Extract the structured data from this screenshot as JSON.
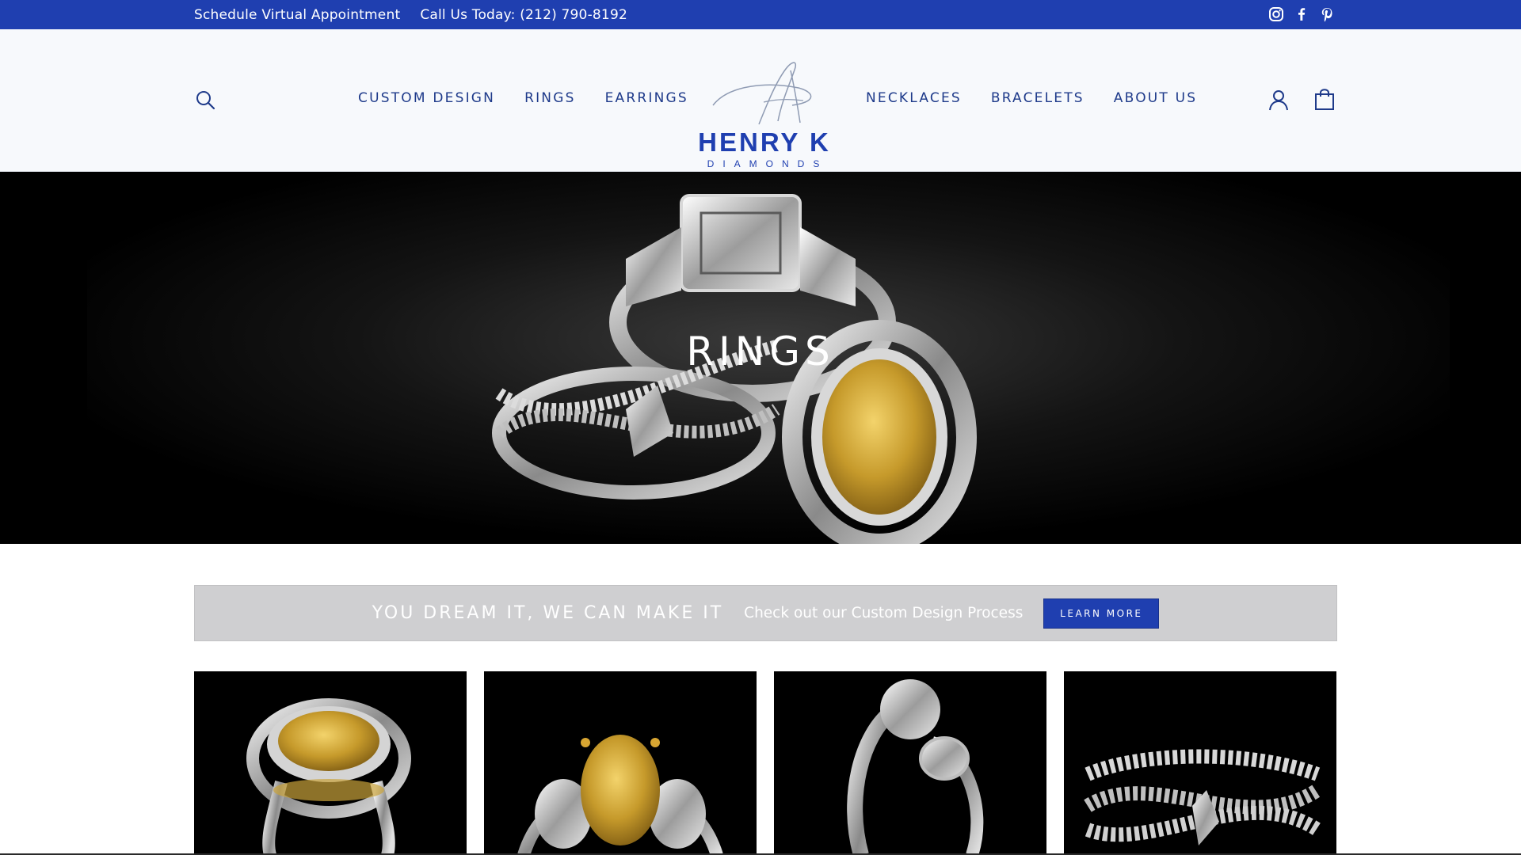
{
  "topbar": {
    "schedule_link": "Schedule Virtual Appointment",
    "phone_link": "Call Us Today: (212) 790-8192",
    "social": [
      "instagram-icon",
      "facebook-icon",
      "pinterest-icon"
    ]
  },
  "header": {
    "nav_left": [
      "CUSTOM DESIGN",
      "RINGS",
      "EARRINGS"
    ],
    "nav_right": [
      "NECKLACES",
      "BRACELETS",
      "ABOUT US"
    ],
    "logo_line1": "HENRY K",
    "logo_line2": "DIAMONDS",
    "icons": [
      "search-icon",
      "account-icon",
      "cart-icon"
    ]
  },
  "hero": {
    "title": "RINGS"
  },
  "promo": {
    "headline": "YOU DREAM IT, WE CAN MAKE IT",
    "subtext": "Check out our Custom Design Process",
    "button_label": "LEARN MORE"
  },
  "products": [
    {
      "image": "yellow-oval-halo-ring"
    },
    {
      "image": "yellow-oval-three-stone-ring"
    },
    {
      "image": "diamond-bypass-ring"
    },
    {
      "image": "crossover-pave-ring"
    }
  ],
  "colors": {
    "brand_blue": "#1f3fb0",
    "nav_text": "#1e3a8a",
    "header_bg": "#f7f9fc",
    "promo_bg": "#cfcfd1"
  }
}
